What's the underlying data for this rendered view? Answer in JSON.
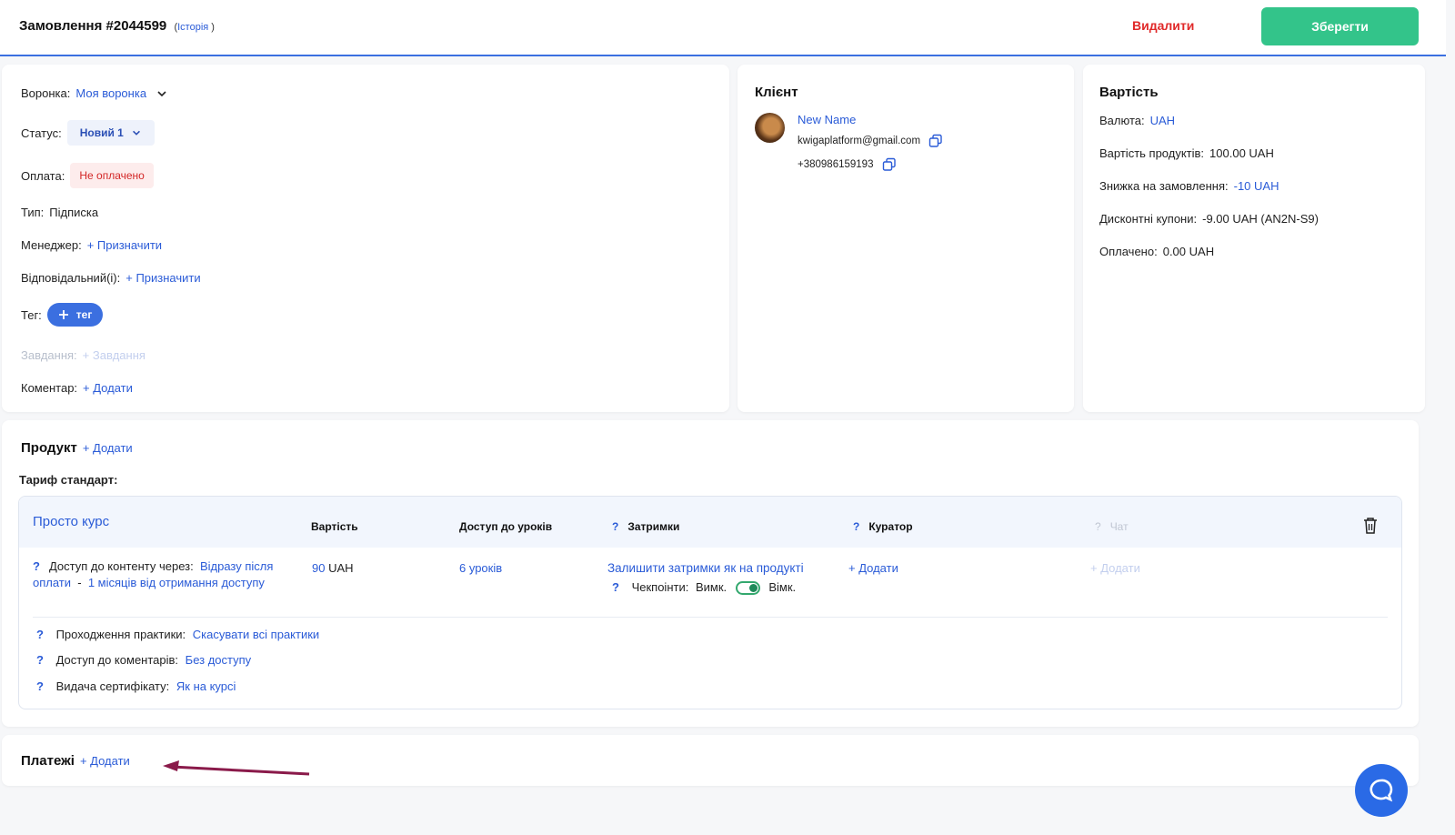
{
  "header": {
    "title": "Замовлення #2044599",
    "history_link": "Історія",
    "delete_label": "Видалити",
    "save_label": "Зберегти"
  },
  "order": {
    "funnel_label": "Воронка:",
    "funnel_value": "Моя воронка",
    "status_label": "Статус:",
    "status_value": "Новий 1",
    "payment_label": "Оплата:",
    "payment_value": "Не оплачено",
    "type_label": "Тип:",
    "type_value": "Підписка",
    "manager_label": "Менеджер:",
    "manager_action": "+ Призначити",
    "responsible_label": "Відповідальний(і):",
    "responsible_action": "+ Призначити",
    "tag_label": "Тег:",
    "tag_button": "тег",
    "task_label": "Завдання:",
    "task_action": "+ Завдання",
    "comment_label": "Коментар:",
    "comment_action": "+ Додати"
  },
  "client": {
    "title": "Клієнт",
    "name": "New Name",
    "email": "kwigaplatform@gmail.com",
    "phone": "+380986159193"
  },
  "cost": {
    "title": "Вартість",
    "currency_label": "Валюта:",
    "currency_value": "UAH",
    "products_label": "Вартість продуктів:",
    "products_value": "100.00 UAH",
    "discount_label": "Знижка на замовлення:",
    "discount_value": "-10 UAH",
    "coupons_label": "Дисконтні купони:",
    "coupons_value": "-9.00 UAH (AN2N-S9)",
    "paid_label": "Оплачено:",
    "paid_value": "0.00 UAH"
  },
  "product": {
    "title": "Продукт",
    "add_action": "+ Додати",
    "tariff": "Тариф стандарт:",
    "course_name": "Просто курс",
    "col_price": "Вартість",
    "col_access": "Доступ до уроків",
    "col_delays": "Затримки",
    "col_curator": "Куратор",
    "col_chat": "Чат",
    "q": "?",
    "access_via_label": "Доступ до контенту через:",
    "access_via_value1": "Відразу",
    "access_via_value2": "після оплати",
    "access_sep": "-",
    "access_via_value3": "1 місяців від отримання",
    "access_via_value4": "доступу",
    "price_num": "90",
    "price_cur": "UAH",
    "lessons": "6 уроків",
    "delays_value": "Залишити затримки як на продукті",
    "checkpoints_label": "Чекпоінти:",
    "checkpoints_off": "Вимк.",
    "checkpoints_on": "Вімк.",
    "curator_add": "+ Додати",
    "chat_add": "+ Додати",
    "practice_label": "Проходження практики:",
    "practice_value": "Скасувати всі практики",
    "comments_label": "Доступ до коментарів:",
    "comments_value": "Без доступу",
    "certificate_label": "Видача сертифікату:",
    "certificate_value": "Як на курсі"
  },
  "payments": {
    "title": "Платежі",
    "add_action": "+ Додати"
  },
  "colors": {
    "accent": "#2a5bd7",
    "save": "#33c48a",
    "danger": "#e02929",
    "annotation_arrow": "#8a1a4a"
  }
}
